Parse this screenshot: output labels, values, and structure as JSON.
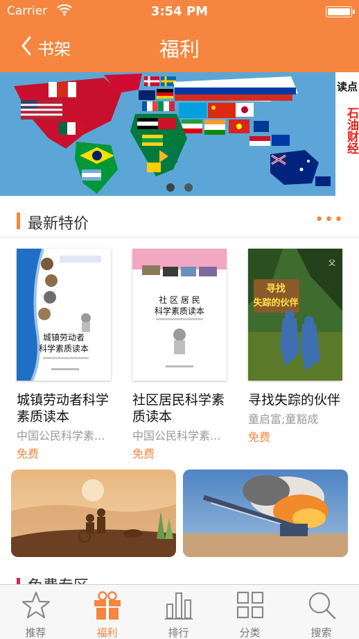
{
  "status_bar": {
    "carrier": "Carrier",
    "time": "3:54 PM"
  },
  "nav": {
    "back_label": "书架",
    "title": "福利"
  },
  "banner": {
    "brand_top": "读点",
    "brand_red": "石油财经",
    "page_count": 2,
    "active_page": 1
  },
  "section": {
    "title": "最新特价",
    "more": "•••"
  },
  "books": [
    {
      "title": "城镇劳动者科学素质读本",
      "author": "中国公民科学素...",
      "price": "免费",
      "cover_text": "城镇劳动者\n科学素质读本"
    },
    {
      "title": "社区居民科学素质读本",
      "author": "中国公民科学素...",
      "price": "免费",
      "cover_text": "社 区 居 民\n科学素质读本"
    },
    {
      "title": "寻找失踪的伙伴",
      "author": "童启富;童豁成",
      "price": "免费",
      "cover_text": "寻找\n失踪的伙伴"
    }
  ],
  "section2": {
    "title": "免费专区"
  },
  "tabs": [
    {
      "label": "推荐",
      "icon": "star-icon",
      "active": false
    },
    {
      "label": "福利",
      "icon": "gift-icon",
      "active": true
    },
    {
      "label": "排行",
      "icon": "bar-chart-icon",
      "active": false
    },
    {
      "label": "分类",
      "icon": "grid-icon",
      "active": false
    },
    {
      "label": "搜索",
      "icon": "search-icon",
      "active": false
    }
  ],
  "colors": {
    "accent": "#F5853F",
    "muted": "#999999"
  }
}
